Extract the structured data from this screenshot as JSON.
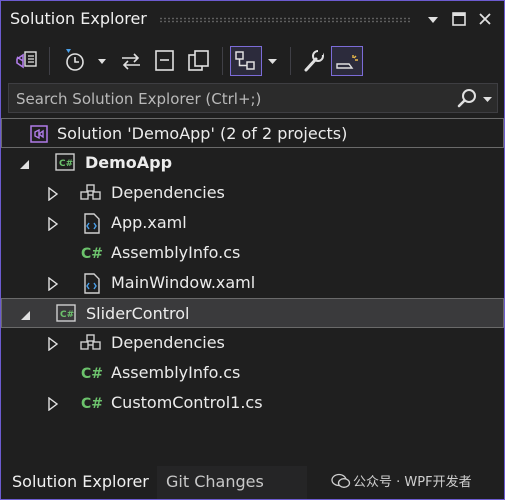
{
  "window": {
    "title": "Solution Explorer",
    "accent": "#7c6cd8"
  },
  "toolbar": {
    "items": [
      {
        "name": "switch-views-icon",
        "pressed": false
      },
      {
        "name": "pending-changes-filter-icon",
        "pressed": false
      },
      {
        "name": "sync-with-active-document-icon",
        "pressed": false
      },
      {
        "name": "collapse-all-icon",
        "pressed": false
      },
      {
        "name": "show-all-files-icon",
        "pressed": false
      },
      {
        "name": "tree-view-filter-icon",
        "pressed": true
      },
      {
        "name": "properties-wrench-icon",
        "pressed": false
      },
      {
        "name": "preview-selected-items-icon",
        "pressed": true
      }
    ]
  },
  "search": {
    "placeholder": "Search Solution Explorer (Ctrl+;)"
  },
  "tree": {
    "solution": "Solution 'DemoApp' (2 of 2 projects)",
    "projects": [
      {
        "name": "DemoApp",
        "bold": true,
        "children": [
          "Dependencies",
          "App.xaml",
          "AssemblyInfo.cs",
          "MainWindow.xaml"
        ]
      },
      {
        "name": "SliderControl",
        "bold": false,
        "children": [
          "Dependencies",
          "AssemblyInfo.cs",
          "CustomControl1.cs"
        ]
      }
    ]
  },
  "tabs": {
    "active": "Solution Explorer",
    "inactive": "Git Changes"
  },
  "watermark": "公众号 · WPF开发者"
}
